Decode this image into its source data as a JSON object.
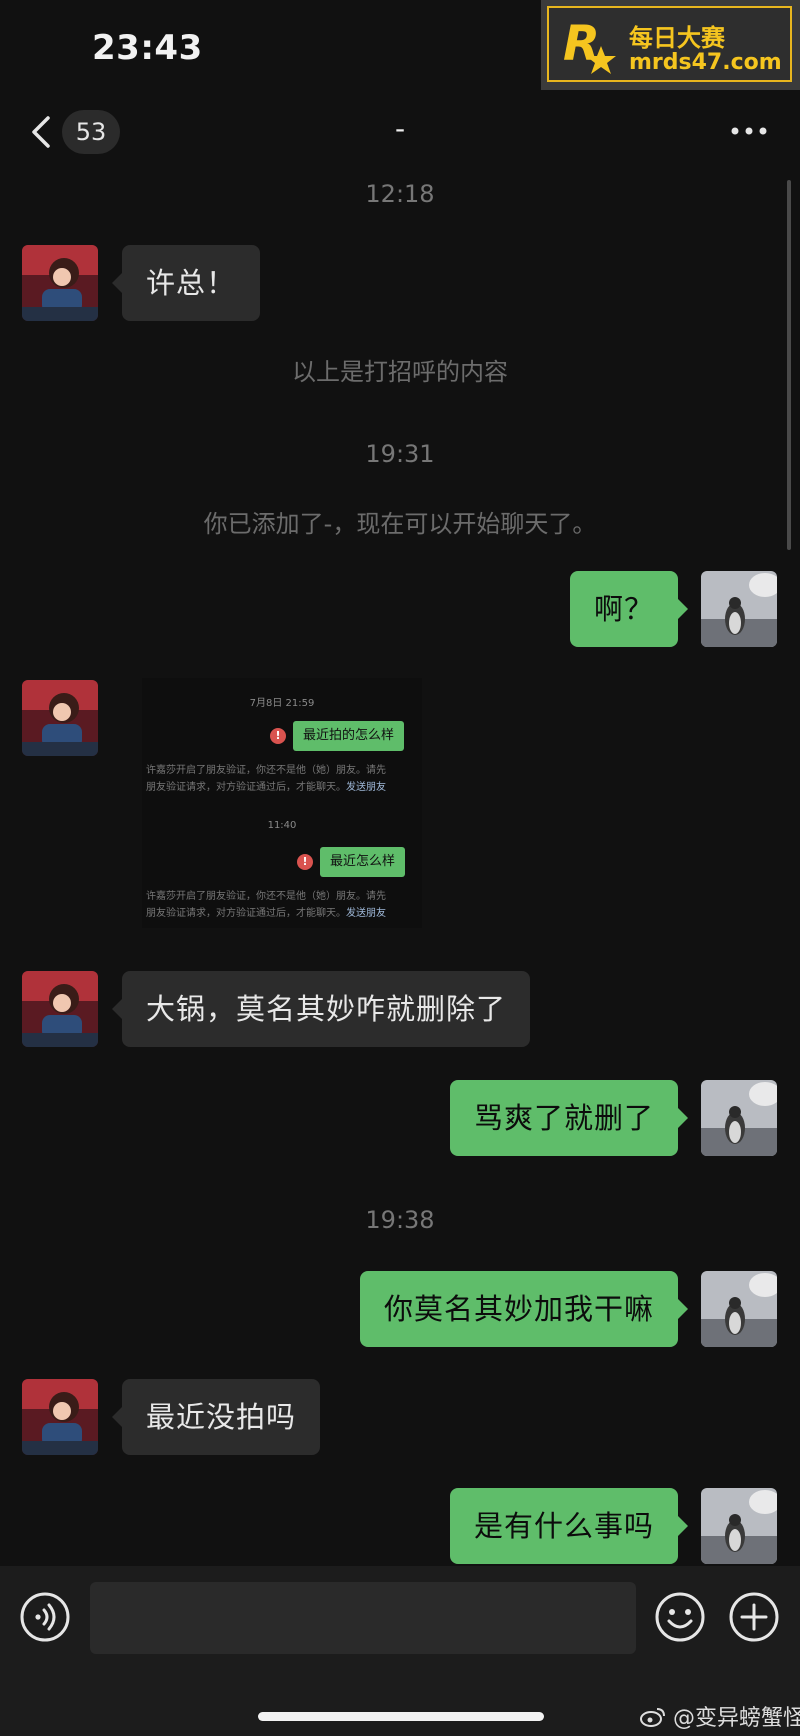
{
  "status_bar": {
    "time": "23:43"
  },
  "watermark": {
    "line1": "每日大赛",
    "line2": "mrds47.com"
  },
  "nav": {
    "unread_count": "53",
    "title": "-"
  },
  "messages": {
    "t1": "12:18",
    "m1": "许总！",
    "n1": "以上是打招呼的内容",
    "t2": "19:31",
    "n2": "你已添加了-，现在可以开始聊天了。",
    "m2": "啊？",
    "m3": "大锅，莫名其妙咋就删除了",
    "m4": "骂爽了就删了",
    "t3": "19:38",
    "m5": "你莫名其妙加我干嘛",
    "m6": "最近没拍吗",
    "m7": "是有什么事吗"
  },
  "screenshot": {
    "time1": "7月8日 21:59",
    "msg1": "最近拍的怎么样",
    "note1_line1": "许嘉莎开启了朋友验证，你还不是他（她）朋友。请先",
    "note1_line2": "朋友验证请求，对方验证通过后，才能聊天。",
    "link": "发送朋友",
    "time2": "11:40",
    "msg2": "最近怎么样",
    "note2_line1": "许嘉莎开启了朋友验证，你还不是他（她）朋友。请先",
    "note2_line2": "朋友验证请求，对方验证通过后，才能聊天。"
  },
  "input": {
    "value": "",
    "placeholder": ""
  },
  "credit": "@变异螃蟹怪",
  "icons": {
    "back": "chevron-left-icon",
    "more": "more-dots-icon",
    "voice": "voice-icon",
    "emoji": "emoji-icon",
    "plus": "plus-icon",
    "weibo": "weibo-icon"
  },
  "colors": {
    "background": "#111111",
    "bubble_out": "#5fbd6a",
    "bubble_in": "#2c2c2c",
    "watermark": "#f5c51f"
  }
}
